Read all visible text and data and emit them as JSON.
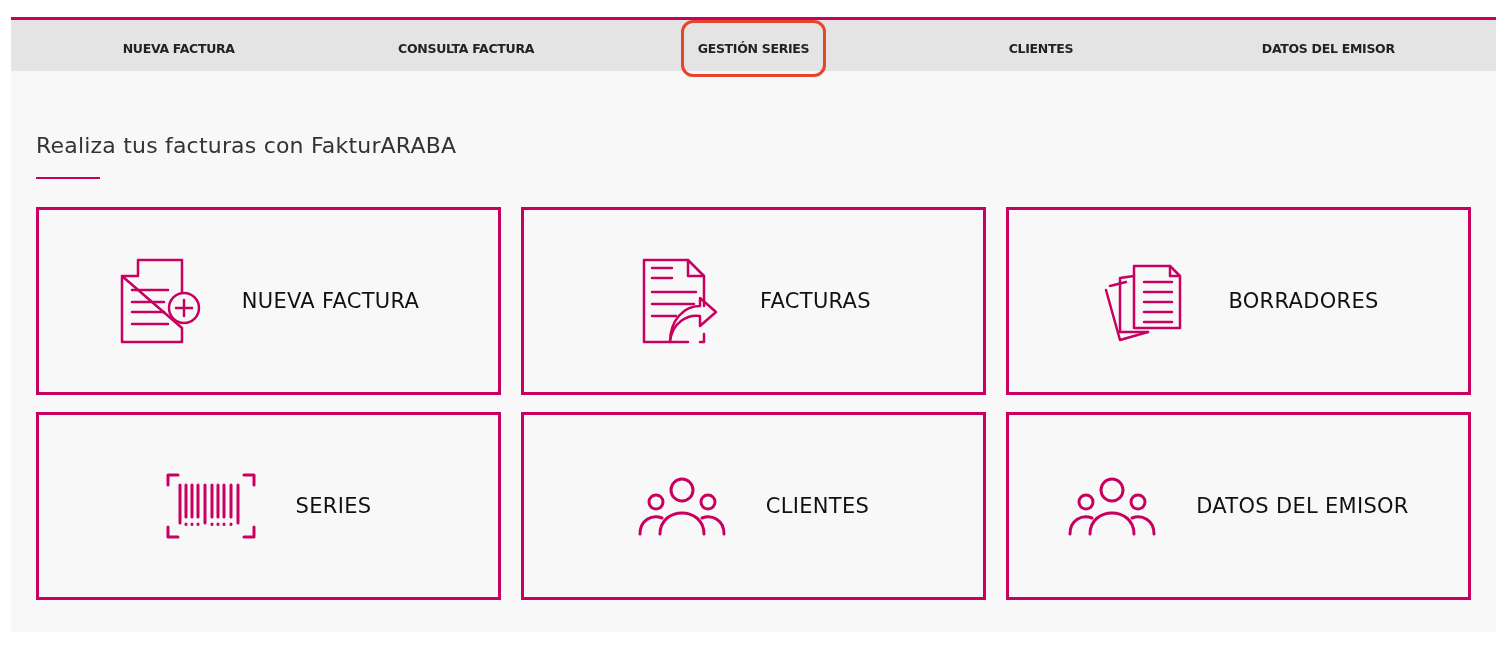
{
  "nav": [
    {
      "label": "NUEVA FACTURA",
      "highlighted": false
    },
    {
      "label": "CONSULTA FACTURA",
      "highlighted": false
    },
    {
      "label": "GESTIÓN SERIES",
      "highlighted": true
    },
    {
      "label": "CLIENTES",
      "highlighted": false
    },
    {
      "label": "DATOS DEL EMISOR",
      "highlighted": false
    }
  ],
  "heading": "Realiza tus facturas con FakturARABA",
  "cards": [
    {
      "label": "NUEVA FACTURA",
      "kind": "document-plus"
    },
    {
      "label": "FACTURAS",
      "kind": "document-share"
    },
    {
      "label": "BORRADORES",
      "kind": "documents"
    },
    {
      "label": "SERIES",
      "kind": "barcode"
    },
    {
      "label": "CLIENTES",
      "kind": "people"
    },
    {
      "label": "DATOS DEL EMISOR",
      "kind": "people"
    }
  ]
}
